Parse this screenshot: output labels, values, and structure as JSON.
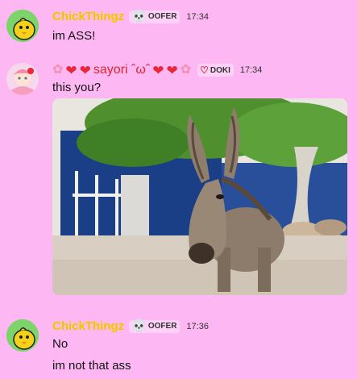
{
  "messages": [
    {
      "username": "ChickThingz",
      "tag": "OOFER",
      "time": "17:34",
      "lines": [
        "im ASS!"
      ]
    },
    {
      "username_prefix": [
        "flower",
        "heart",
        "heart"
      ],
      "username": "sayori ˆωˆ",
      "username_suffix": [
        "heart",
        "heart",
        "flower"
      ],
      "tag": "DOKI",
      "time": "17:34",
      "lines": [
        "this you?"
      ],
      "image": "donkey-photo"
    },
    {
      "username": "ChickThingz",
      "tag": "OOFER",
      "time": "17:36",
      "lines": [
        "No",
        "im not that ass"
      ]
    }
  ],
  "colors": {
    "background": "#fdb8f3",
    "chick_name": "#f2c400",
    "sayori_name": "#e0222c"
  }
}
